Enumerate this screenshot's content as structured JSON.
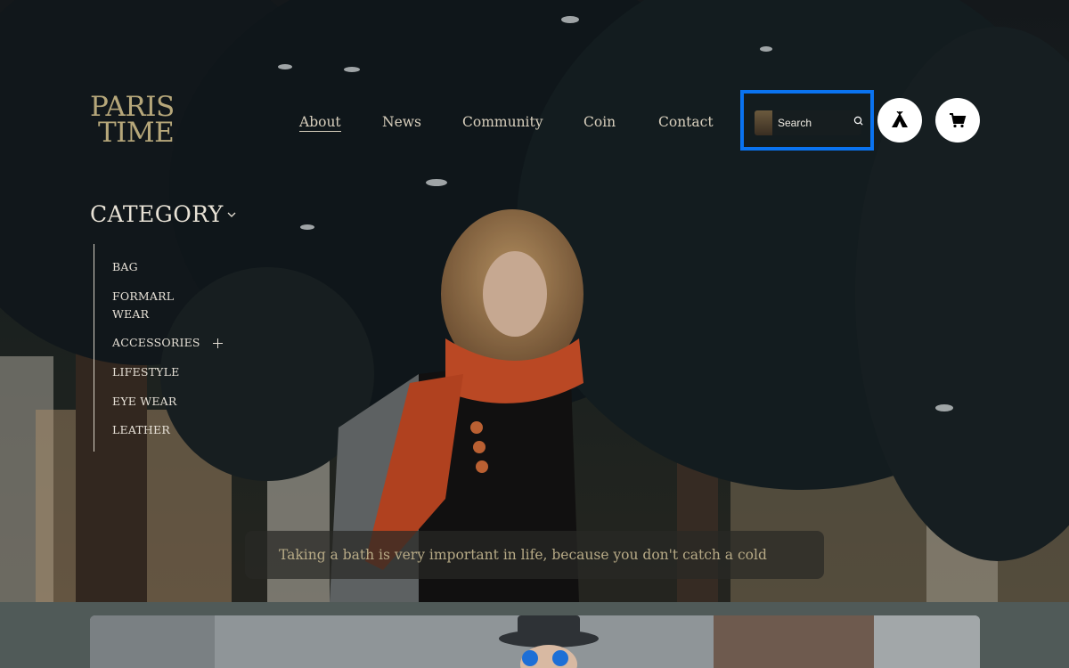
{
  "brand": {
    "logo_line1": "PARIS",
    "logo_line2": "TIME"
  },
  "nav": {
    "items": [
      {
        "label": "About",
        "active": true
      },
      {
        "label": "News",
        "active": false
      },
      {
        "label": "Community",
        "active": false
      },
      {
        "label": "Coin",
        "active": false
      },
      {
        "label": "Contact",
        "active": false
      }
    ]
  },
  "search": {
    "placeholder": "Search",
    "value": "",
    "highlight_color": "#0a73f0"
  },
  "icons": {
    "tent": "tent-icon",
    "cart": "cart-icon",
    "search": "search-icon",
    "chevron": "chevron-down-icon",
    "plus": "plus-icon"
  },
  "category": {
    "title": "CATEGORY",
    "items": [
      {
        "label": "BAG"
      },
      {
        "label": "FORMARL WEAR"
      },
      {
        "label": "ACCESSORIES",
        "expandable": true
      },
      {
        "label": "LIFESTYLE"
      },
      {
        "label": "EYE WEAR"
      },
      {
        "label": "LEATHER"
      }
    ]
  },
  "hero": {
    "caption": "Taking a bath is very important in life, because you don't catch a cold"
  },
  "colors": {
    "brand_gold": "#b6a77a",
    "text_light": "#e6e0d6",
    "band": "#505a58"
  }
}
